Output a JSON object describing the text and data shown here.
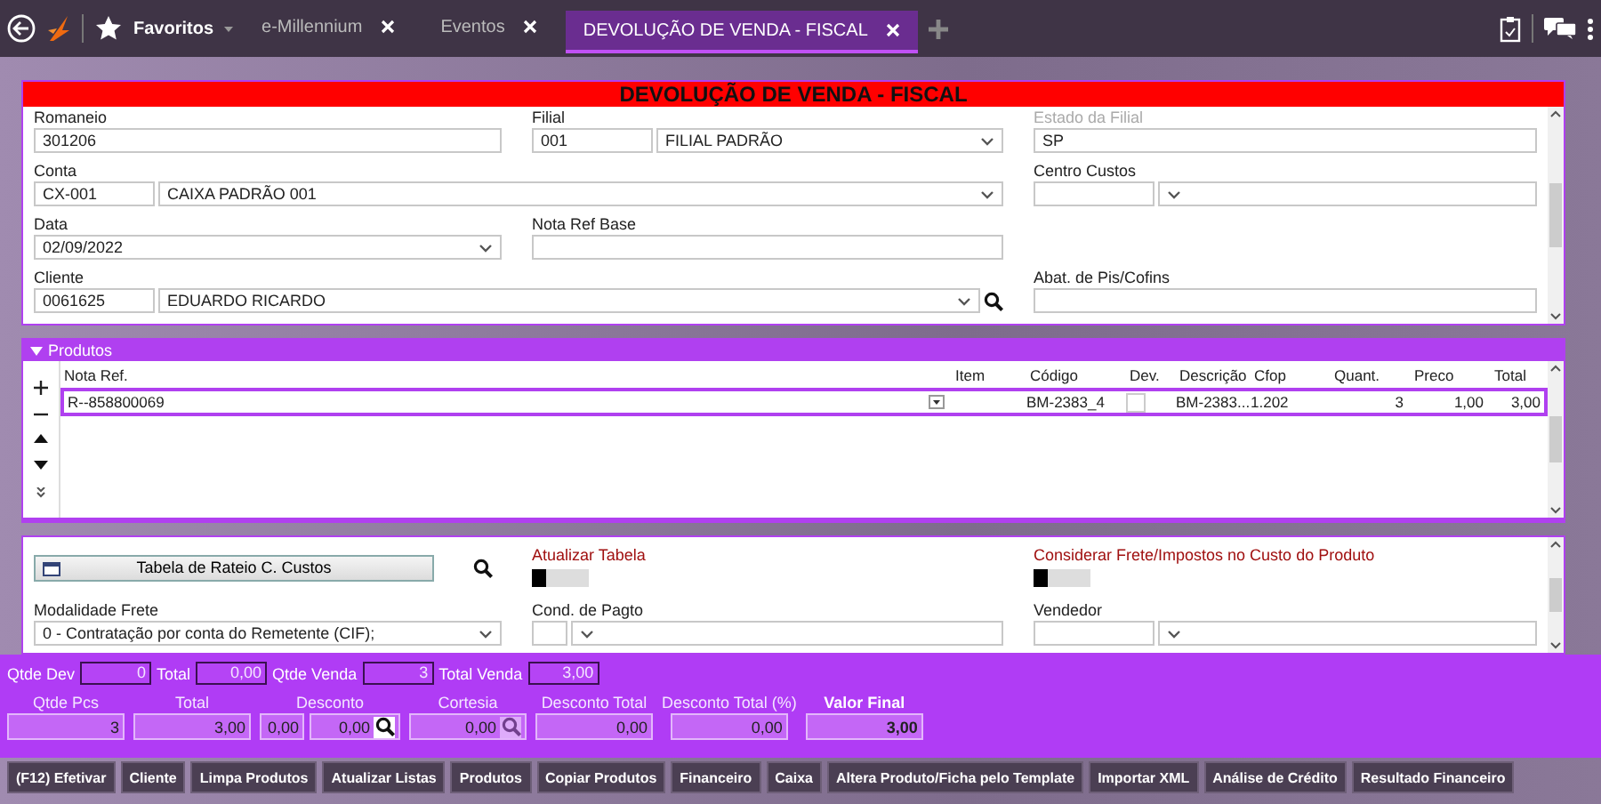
{
  "topbar": {
    "favorites": "Favoritos",
    "tabs": [
      {
        "label": "e-Millennium",
        "selected": false
      },
      {
        "label": "Eventos",
        "selected": false
      },
      {
        "label": "DEVOLUÇÃO DE VENDA - FISCAL",
        "selected": true
      }
    ]
  },
  "form": {
    "title": "DEVOLUÇÃO DE VENDA - FISCAL",
    "fields": [
      {
        "label": "Romaneio",
        "disabled": false,
        "wide": false,
        "search": false,
        "inputs": [
          {
            "kind": "text",
            "value": "301206"
          }
        ]
      },
      {
        "label": "Filial",
        "disabled": false,
        "wide": false,
        "search": false,
        "inputs": [
          {
            "kind": "code",
            "value": "001"
          },
          {
            "kind": "select",
            "value": "FILIAL PADRÃO"
          }
        ]
      },
      {
        "label": "Estado da Filial",
        "disabled": true,
        "wide": false,
        "search": false,
        "inputs": [
          {
            "kind": "text",
            "value": "SP"
          }
        ]
      },
      {
        "label": "Conta",
        "disabled": false,
        "wide": true,
        "search": false,
        "inputs": [
          {
            "kind": "code",
            "value": "CX-001"
          },
          {
            "kind": "select",
            "value": "CAIXA PADRÃO 001"
          }
        ]
      },
      {
        "label": "Centro Custos",
        "disabled": false,
        "wide": false,
        "search": false,
        "inputs": [
          {
            "kind": "code"
          },
          {
            "kind": "select"
          }
        ]
      },
      {
        "label": "Data",
        "disabled": false,
        "wide": false,
        "search": false,
        "inputs": [
          {
            "kind": "select",
            "value": "02/09/2022"
          }
        ]
      },
      {
        "label": "Nota Ref Base",
        "disabled": false,
        "wide": false,
        "search": false,
        "inputs": [
          {
            "kind": "text"
          }
        ]
      },
      {
        "label": "Cliente",
        "disabled": false,
        "wide": true,
        "search": true,
        "inputs": [
          {
            "kind": "code",
            "value": "0061625"
          },
          {
            "kind": "select",
            "value": "EDUARDO RICARDO"
          }
        ]
      },
      {
        "label": "Abat. de Pis/Cofins",
        "disabled": false,
        "wide": false,
        "search": false,
        "inputs": [
          {
            "kind": "text"
          }
        ]
      }
    ]
  },
  "produtos": {
    "title": "Produtos",
    "expanded": true,
    "columns": [
      "Nota Ref.",
      "Item",
      "Código",
      "Dev.",
      "Descrição",
      "Cfop",
      "Quant.",
      "Preco",
      "Total"
    ],
    "rows": [
      {
        "selected": true,
        "nota_ref": "R--858800069",
        "codigo": "BM-2383_4",
        "dev": false,
        "descricao": "BM-2383...",
        "cfop": "1.202",
        "quant": "3",
        "preco": "1,00",
        "total": "3,00"
      }
    ]
  },
  "extras": [
    {
      "kind": "button",
      "label": "Tabela de Rateio C. Custos"
    },
    {
      "kind": "toggle",
      "label": "Atualizar Tabela",
      "on": false
    },
    {
      "kind": "toggle",
      "label": "Considerar Frete/Impostos no Custo do Produto",
      "on": false
    },
    {
      "kind": "field",
      "label": "Modalidade Frete",
      "inputs": [
        {
          "kind": "select",
          "value": "0 - Contratação por conta do Remetente (CIF);"
        }
      ]
    },
    {
      "kind": "field",
      "label": "Cond. de Pagto",
      "inputs": [
        {
          "kind": "short"
        },
        {
          "kind": "select"
        }
      ]
    },
    {
      "kind": "field",
      "label": "Vendedor",
      "inputs": [
        {
          "kind": "code"
        },
        {
          "kind": "select"
        }
      ]
    }
  ],
  "summary": [
    {
      "label": "Qtde Dev",
      "value": "0"
    },
    {
      "label": "Total",
      "value": "0,00"
    },
    {
      "label": "Qtde Venda",
      "value": "3"
    },
    {
      "label": "Total Venda",
      "value": "3,00"
    }
  ],
  "totals": [
    {
      "label": "Qtde Pcs",
      "strong": false,
      "boxes": [
        {
          "value": "3"
        }
      ]
    },
    {
      "label": "Total",
      "strong": false,
      "boxes": [
        {
          "value": "3,00"
        }
      ]
    },
    {
      "label": "Desconto",
      "strong": false,
      "boxes": [
        {
          "value": "0,00"
        },
        {
          "value": "0,00",
          "search": true,
          "disabled": false
        }
      ]
    },
    {
      "label": "Cortesia",
      "strong": false,
      "boxes": [
        {
          "value": "0,00",
          "search": true,
          "disabled": true
        }
      ]
    },
    {
      "label": "Desconto Total",
      "strong": false,
      "boxes": [
        {
          "value": "0,00"
        }
      ]
    },
    {
      "label": "Desconto Total (%)",
      "strong": false,
      "boxes": [
        {
          "value": "0,00"
        }
      ]
    },
    {
      "label": "Valor Final",
      "strong": true,
      "boxes": [
        {
          "value": "3,00"
        }
      ]
    }
  ],
  "buttons": [
    "(F12) Efetivar",
    "Cliente",
    "Limpa Produtos",
    "Atualizar Listas",
    "Produtos",
    "Copiar Produtos",
    "Financeiro",
    "Caixa",
    "Altera Produto/Ficha pelo Template",
    "Importar XML",
    "Análise de Crédito",
    "Resultado Financeiro"
  ]
}
